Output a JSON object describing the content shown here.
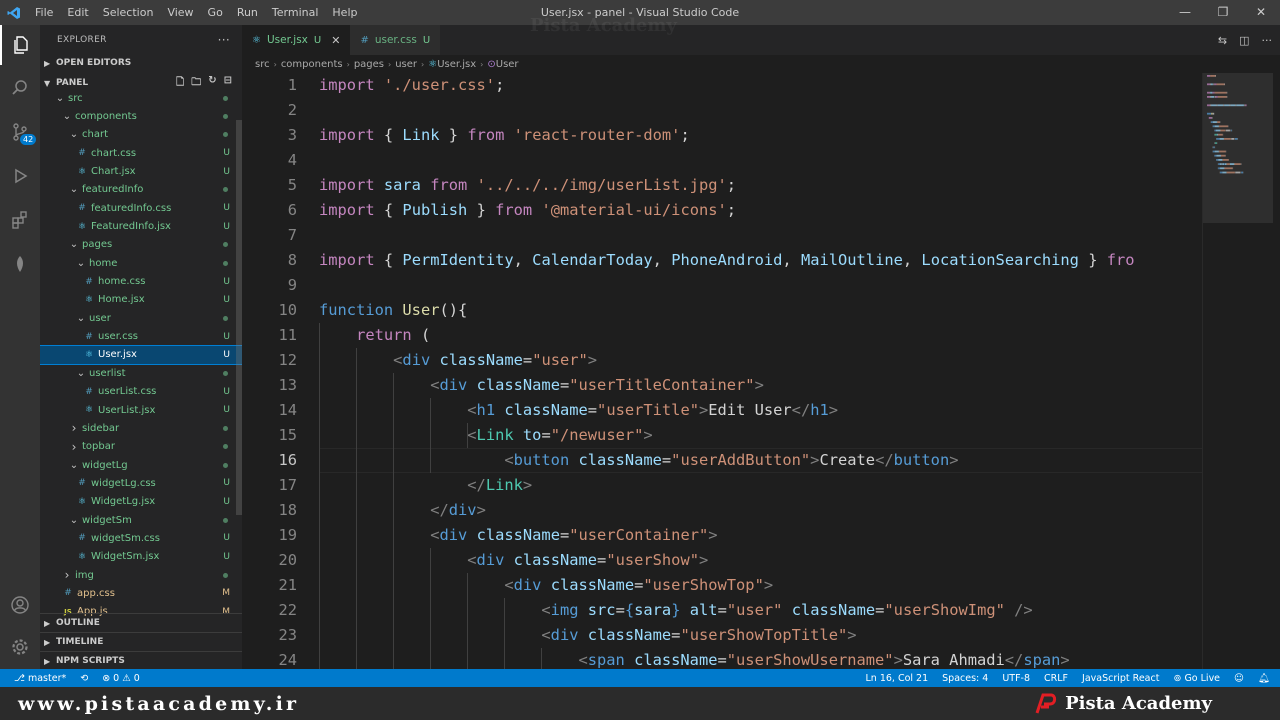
{
  "titlebar": {
    "menus": [
      "File",
      "Edit",
      "Selection",
      "View",
      "Go",
      "Run",
      "Terminal",
      "Help"
    ],
    "title": "User.jsx - panel - Visual Studio Code",
    "controls": [
      "—",
      "❐",
      "✕"
    ]
  },
  "activity": {
    "scm_badge": "42"
  },
  "sidebar": {
    "header": "EXPLORER",
    "more": "···",
    "open_editors": "OPEN EDITORS",
    "panel": "PANEL",
    "tree": [
      {
        "depth": 1,
        "type": "folder",
        "open": true,
        "label": "src",
        "status": "dot"
      },
      {
        "depth": 2,
        "type": "folder",
        "open": true,
        "label": "components",
        "status": "dot"
      },
      {
        "depth": 3,
        "type": "folder",
        "open": true,
        "label": "chart",
        "status": "dot"
      },
      {
        "depth": 4,
        "type": "css",
        "label": "chart.css",
        "status": "U"
      },
      {
        "depth": 4,
        "type": "jsx",
        "label": "Chart.jsx",
        "status": "U"
      },
      {
        "depth": 3,
        "type": "folder",
        "open": true,
        "label": "featuredInfo",
        "status": "dot"
      },
      {
        "depth": 4,
        "type": "css",
        "label": "featuredInfo.css",
        "status": "U"
      },
      {
        "depth": 4,
        "type": "jsx",
        "label": "FeaturedInfo.jsx",
        "status": "U"
      },
      {
        "depth": 3,
        "type": "folder",
        "open": true,
        "label": "pages",
        "status": "dot"
      },
      {
        "depth": 4,
        "type": "folder",
        "open": true,
        "label": "home",
        "status": "dot"
      },
      {
        "depth": 5,
        "type": "css",
        "label": "home.css",
        "status": "U"
      },
      {
        "depth": 5,
        "type": "jsx",
        "label": "Home.jsx",
        "status": "U"
      },
      {
        "depth": 4,
        "type": "folder",
        "open": true,
        "label": "user",
        "status": "dot"
      },
      {
        "depth": 5,
        "type": "css",
        "label": "user.css",
        "status": "U"
      },
      {
        "depth": 5,
        "type": "jsx",
        "label": "User.jsx",
        "status": "U",
        "selected": true
      },
      {
        "depth": 4,
        "type": "folder",
        "open": true,
        "label": "userlist",
        "status": "dot"
      },
      {
        "depth": 5,
        "type": "css",
        "label": "userList.css",
        "status": "U"
      },
      {
        "depth": 5,
        "type": "jsx",
        "label": "UserList.jsx",
        "status": "U"
      },
      {
        "depth": 3,
        "type": "folder",
        "open": false,
        "label": "sidebar",
        "status": "dot"
      },
      {
        "depth": 3,
        "type": "folder",
        "open": false,
        "label": "topbar",
        "status": "dot"
      },
      {
        "depth": 3,
        "type": "folder",
        "open": true,
        "label": "widgetLg",
        "status": "dot"
      },
      {
        "depth": 4,
        "type": "css",
        "label": "widgetLg.css",
        "status": "U"
      },
      {
        "depth": 4,
        "type": "jsx",
        "label": "WidgetLg.jsx",
        "status": "U"
      },
      {
        "depth": 3,
        "type": "folder",
        "open": true,
        "label": "widgetSm",
        "status": "dot"
      },
      {
        "depth": 4,
        "type": "css",
        "label": "widgetSm.css",
        "status": "U"
      },
      {
        "depth": 4,
        "type": "jsx",
        "label": "WidgetSm.jsx",
        "status": "U"
      },
      {
        "depth": 2,
        "type": "folder",
        "open": false,
        "label": "img",
        "status": "dot"
      },
      {
        "depth": 2,
        "type": "css",
        "label": "app.css",
        "status": "M"
      },
      {
        "depth": 2,
        "type": "js",
        "label": "App.js",
        "status": "M"
      }
    ],
    "outline": "OUTLINE",
    "timeline": "TIMELINE",
    "npm": "NPM SCRIPTS"
  },
  "tabs": [
    {
      "label": "User.jsx",
      "status": "U",
      "active": true
    },
    {
      "label": "user.css",
      "status": "U",
      "active": false
    }
  ],
  "breadcrumb": [
    "src",
    "components",
    "pages",
    "user",
    "User.jsx",
    "User"
  ],
  "editor": {
    "current_line": 16,
    "lines": [
      [
        [
          "kw",
          "import "
        ],
        [
          "str",
          "'./user.css'"
        ],
        [
          "txt",
          ";"
        ]
      ],
      [],
      [
        [
          "kw",
          "import "
        ],
        [
          "txt",
          "{ "
        ],
        [
          "id",
          "Link"
        ],
        [
          "txt",
          " } "
        ],
        [
          "kw",
          "from "
        ],
        [
          "str",
          "'react-router-dom'"
        ],
        [
          "txt",
          ";"
        ]
      ],
      [],
      [
        [
          "kw",
          "import "
        ],
        [
          "id",
          "sara "
        ],
        [
          "kw",
          "from "
        ],
        [
          "str",
          "'../../../img/userList.jpg'"
        ],
        [
          "txt",
          ";"
        ]
      ],
      [
        [
          "kw",
          "import "
        ],
        [
          "txt",
          "{ "
        ],
        [
          "id",
          "Publish"
        ],
        [
          "txt",
          " } "
        ],
        [
          "kw",
          "from "
        ],
        [
          "str",
          "'@material-ui/icons'"
        ],
        [
          "txt",
          ";"
        ]
      ],
      [],
      [
        [
          "kw",
          "import "
        ],
        [
          "txt",
          "{ "
        ],
        [
          "id",
          "PermIdentity"
        ],
        [
          "txt",
          ", "
        ],
        [
          "id",
          "CalendarToday"
        ],
        [
          "txt",
          ", "
        ],
        [
          "id",
          "PhoneAndroid"
        ],
        [
          "txt",
          ", "
        ],
        [
          "id",
          "MailOutline"
        ],
        [
          "txt",
          ", "
        ],
        [
          "id",
          "LocationSearching"
        ],
        [
          "txt",
          " } "
        ],
        [
          "kw",
          "fro"
        ]
      ],
      [],
      [
        [
          "kw2",
          "function "
        ],
        [
          "fn",
          "User"
        ],
        [
          "txt",
          "(){"
        ]
      ],
      [
        [
          "txt",
          "    "
        ],
        [
          "kw",
          "return "
        ],
        [
          "txt",
          "("
        ]
      ],
      [
        [
          "txt",
          "        "
        ],
        [
          "brk",
          "<"
        ],
        [
          "tag",
          "div "
        ],
        [
          "attr",
          "className"
        ],
        [
          "txt",
          "="
        ],
        [
          "str",
          "\"user\""
        ],
        [
          "brk",
          ">"
        ]
      ],
      [
        [
          "txt",
          "            "
        ],
        [
          "brk",
          "<"
        ],
        [
          "tag",
          "div "
        ],
        [
          "attr",
          "className"
        ],
        [
          "txt",
          "="
        ],
        [
          "str",
          "\"userTitleContainer\""
        ],
        [
          "brk",
          ">"
        ]
      ],
      [
        [
          "txt",
          "                "
        ],
        [
          "brk",
          "<"
        ],
        [
          "tag",
          "h1 "
        ],
        [
          "attr",
          "className"
        ],
        [
          "txt",
          "="
        ],
        [
          "str",
          "\"userTitle\""
        ],
        [
          "brk",
          ">"
        ],
        [
          "txt",
          "Edit User"
        ],
        [
          "brk",
          "</"
        ],
        [
          "tag",
          "h1"
        ],
        [
          "brk",
          ">"
        ]
      ],
      [
        [
          "txt",
          "                "
        ],
        [
          "brk",
          "<"
        ],
        [
          "comp",
          "Link "
        ],
        [
          "attr",
          "to"
        ],
        [
          "txt",
          "="
        ],
        [
          "str",
          "\"/newuser\""
        ],
        [
          "brk",
          ">"
        ]
      ],
      [
        [
          "txt",
          "                    "
        ],
        [
          "brk",
          "<"
        ],
        [
          "tag",
          "button "
        ],
        [
          "attr",
          "className"
        ],
        [
          "txt",
          "="
        ],
        [
          "str",
          "\"userAddButton\""
        ],
        [
          "brk",
          ">"
        ],
        [
          "txt",
          "Create"
        ],
        [
          "brk",
          "</"
        ],
        [
          "tag",
          "button"
        ],
        [
          "brk",
          ">"
        ]
      ],
      [
        [
          "txt",
          "                "
        ],
        [
          "brk",
          "</"
        ],
        [
          "comp",
          "Link"
        ],
        [
          "brk",
          ">"
        ]
      ],
      [
        [
          "txt",
          "            "
        ],
        [
          "brk",
          "</"
        ],
        [
          "tag",
          "div"
        ],
        [
          "brk",
          ">"
        ]
      ],
      [
        [
          "txt",
          "            "
        ],
        [
          "brk",
          "<"
        ],
        [
          "tag",
          "div "
        ],
        [
          "attr",
          "className"
        ],
        [
          "txt",
          "="
        ],
        [
          "str",
          "\"userContainer\""
        ],
        [
          "brk",
          ">"
        ]
      ],
      [
        [
          "txt",
          "                "
        ],
        [
          "brk",
          "<"
        ],
        [
          "tag",
          "div "
        ],
        [
          "attr",
          "className"
        ],
        [
          "txt",
          "="
        ],
        [
          "str",
          "\"userShow\""
        ],
        [
          "brk",
          ">"
        ]
      ],
      [
        [
          "txt",
          "                    "
        ],
        [
          "brk",
          "<"
        ],
        [
          "tag",
          "div "
        ],
        [
          "attr",
          "className"
        ],
        [
          "txt",
          "="
        ],
        [
          "str",
          "\"userShowTop\""
        ],
        [
          "brk",
          ">"
        ]
      ],
      [
        [
          "txt",
          "                        "
        ],
        [
          "brk",
          "<"
        ],
        [
          "tag",
          "img "
        ],
        [
          "attr",
          "src"
        ],
        [
          "txt",
          "="
        ],
        [
          "kw2",
          "{"
        ],
        [
          "id",
          "sara"
        ],
        [
          "kw2",
          "} "
        ],
        [
          "attr",
          "alt"
        ],
        [
          "txt",
          "="
        ],
        [
          "str",
          "\"user\" "
        ],
        [
          "attr",
          "className"
        ],
        [
          "txt",
          "="
        ],
        [
          "str",
          "\"userShowImg\" "
        ],
        [
          "brk",
          "/>"
        ]
      ],
      [
        [
          "txt",
          "                        "
        ],
        [
          "brk",
          "<"
        ],
        [
          "tag",
          "div "
        ],
        [
          "attr",
          "className"
        ],
        [
          "txt",
          "="
        ],
        [
          "str",
          "\"userShowTopTitle\""
        ],
        [
          "brk",
          ">"
        ]
      ],
      [
        [
          "txt",
          "                            "
        ],
        [
          "brk",
          "<"
        ],
        [
          "tag",
          "span "
        ],
        [
          "attr",
          "className"
        ],
        [
          "txt",
          "="
        ],
        [
          "str",
          "\"userShowUsername\""
        ],
        [
          "brk",
          ">"
        ],
        [
          "txt",
          "Sara Ahmadi"
        ],
        [
          "brk",
          "</"
        ],
        [
          "tag",
          "span"
        ],
        [
          "brk",
          ">"
        ]
      ]
    ]
  },
  "statusbar": {
    "branch": "master*",
    "problems": "⊗ 0 ⚠ 0",
    "position": "Ln 16, Col 21",
    "spaces": "Spaces: 4",
    "encoding": "UTF-8",
    "eol": "CRLF",
    "language": "JavaScript React",
    "golive": "Go Live"
  },
  "banner": {
    "url": "www.pistaacademy.ir",
    "brand": "Pista Academy"
  },
  "watermark": "Pista Academy",
  "colors": {
    "accent": "#007acc",
    "untracked": "#73c991",
    "modified": "#e2c08d"
  }
}
